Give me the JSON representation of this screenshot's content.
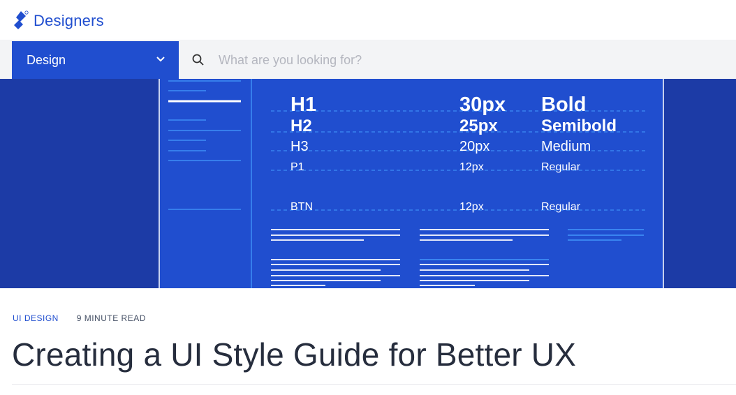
{
  "brand": {
    "name": "Designers"
  },
  "nav": {
    "section_label": "Design",
    "search_placeholder": "What are you looking for?"
  },
  "hero": {
    "rows": [
      {
        "tag": "H1",
        "size": "30px",
        "weight": "Bold"
      },
      {
        "tag": "H2",
        "size": "25px",
        "weight": "Semibold"
      },
      {
        "tag": "H3",
        "size": "20px",
        "weight": "Medium"
      },
      {
        "tag": "P1",
        "size": "12px",
        "weight": "Regular"
      },
      {
        "tag": "BTN",
        "size": "12px",
        "weight": "Regular"
      }
    ]
  },
  "article": {
    "category": "UI DESIGN",
    "read_time": "9 MINUTE READ",
    "title": "Creating a UI Style Guide for Better UX"
  },
  "colors": {
    "accent": "#204ecf",
    "hero_dark": "#1c3ba6",
    "hero_panel": "#204ecf",
    "hero_line": "#3d8df5"
  },
  "icons": {
    "logo": "toptal-logo-icon",
    "dropdown": "chevron-down-icon",
    "search": "search-icon"
  }
}
